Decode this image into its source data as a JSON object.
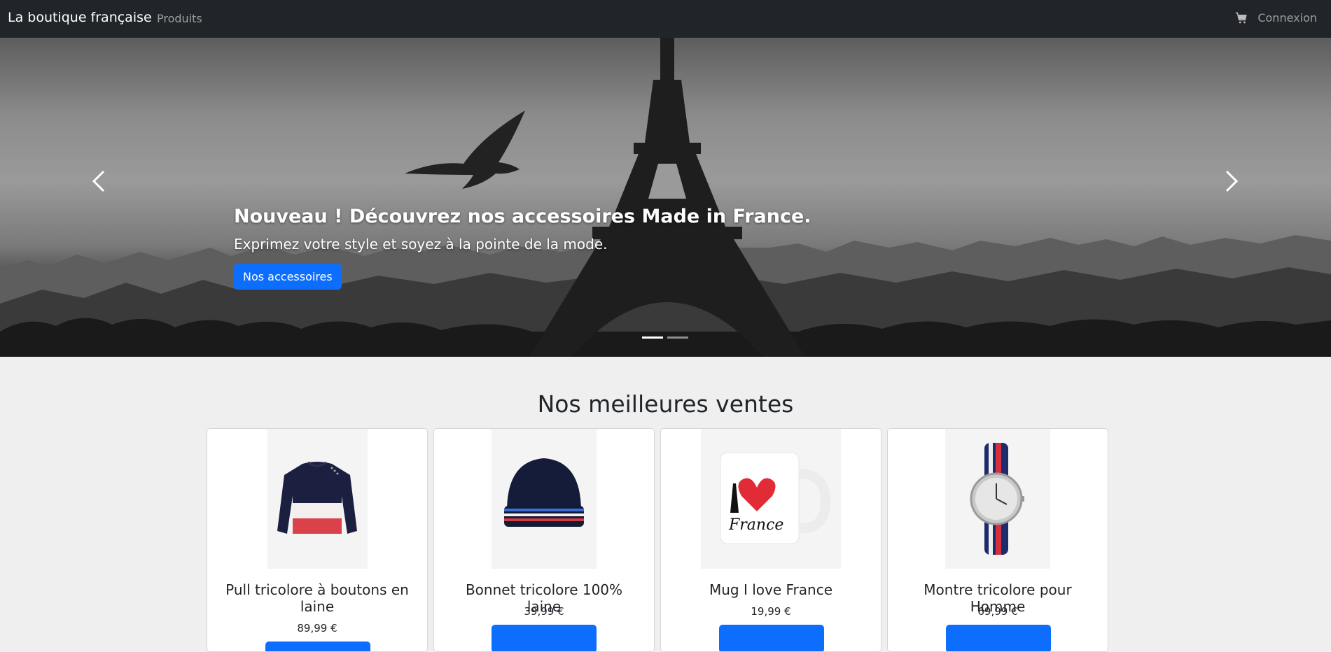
{
  "navbar": {
    "brand": "La boutique française",
    "links": [
      "Produits"
    ],
    "cart_icon": "cart-icon",
    "login": "Connexion"
  },
  "hero": {
    "title": "Nouveau ! Découvrez nos accessoires Made in France.",
    "subtitle": "Exprimez votre style et soyez à la pointe de la mode.",
    "cta": "Nos accessoires",
    "slides_count": 2,
    "active_slide": 1,
    "prev_icon": "chevron-left-icon",
    "next_icon": "chevron-right-icon"
  },
  "bestsellers": {
    "title": "Nos meilleures ventes",
    "products": [
      {
        "name": "Pull tricolore à boutons en laine",
        "price": "89,99 €",
        "image": "sweater"
      },
      {
        "name": "Bonnet tricolore 100% laine",
        "price": "39,99 €",
        "image": "beanie"
      },
      {
        "name": "Mug I love France",
        "price": "19,99 €",
        "image": "mug",
        "image_text": "France"
      },
      {
        "name": "Montre tricolore pour Homme",
        "price": "69,99 €",
        "image": "watch"
      }
    ]
  },
  "colors": {
    "navbar": "#212529",
    "primary": "#0d6efd",
    "background": "#efefef"
  }
}
